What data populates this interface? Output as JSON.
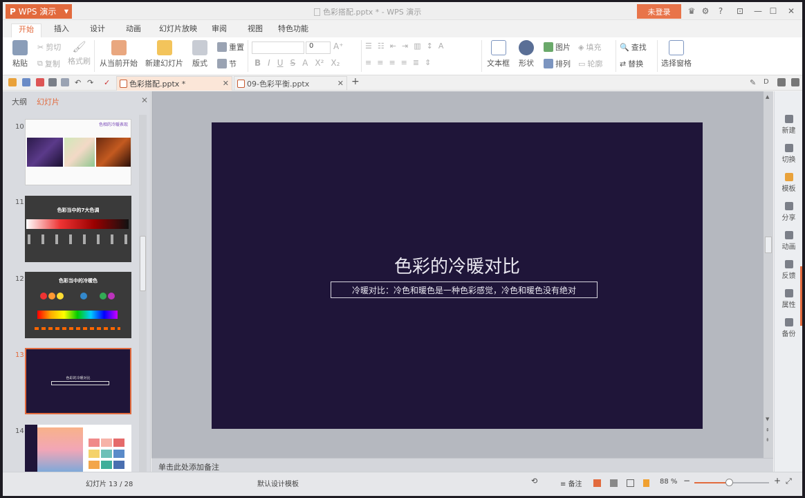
{
  "app": {
    "name": "WPS 演示",
    "doc_title": "色彩搭配.pptx * - WPS 演示",
    "login_label": "未登录"
  },
  "ribbon_tabs": [
    "开始",
    "插入",
    "设计",
    "动画",
    "幻灯片放映",
    "审阅",
    "视图",
    "特色功能"
  ],
  "ribbon": {
    "paste": "粘贴",
    "cut": "剪切",
    "copy": "复制",
    "format_painter": "格式刷",
    "from_current": "从当前开始",
    "new_slide": "新建幻灯片",
    "layout": "版式",
    "section": "节",
    "reset": "重置",
    "font_size": "0",
    "textbox": "文本框",
    "shape": "形状",
    "picture": "图片",
    "arrange": "排列",
    "fill": "填充",
    "outline": "轮廓",
    "find": "查找",
    "replace": "替换",
    "selection_pane": "选择窗格"
  },
  "doc_tabs": [
    {
      "label": "色彩搭配.pptx *",
      "active": true
    },
    {
      "label": "09-色彩平衡.pptx",
      "active": false
    }
  ],
  "left_panel": {
    "tab_outline": "大纲",
    "tab_slides": "幻灯片",
    "slides": [
      {
        "num": "10",
        "title": "色相的冷暖表现"
      },
      {
        "num": "11",
        "title": "色彩当中的7大色调"
      },
      {
        "num": "12",
        "title": "色彩当中的冷暖色"
      },
      {
        "num": "13",
        "title": "色彩的冷暖对比",
        "active": true
      },
      {
        "num": "14",
        "title": ""
      }
    ]
  },
  "slide": {
    "title": "色彩的冷暖对比",
    "subtitle": "冷暖对比：冷色和暖色是一种色彩感觉，冷色和暖色没有绝对"
  },
  "notes_placeholder": "单击此处添加备注",
  "right_sidebar": [
    "新建",
    "切换",
    "模板",
    "分享",
    "动画",
    "反馈",
    "属性",
    "备份"
  ],
  "status": {
    "slide_counter": "幻灯片 13 / 28",
    "template": "默认设计模板",
    "notes_btn": "备注",
    "zoom": "88 %",
    "zoom_fraction": 0.46
  },
  "colors": {
    "accent": "#e26a3d",
    "slide_bg": "#1f1539"
  }
}
